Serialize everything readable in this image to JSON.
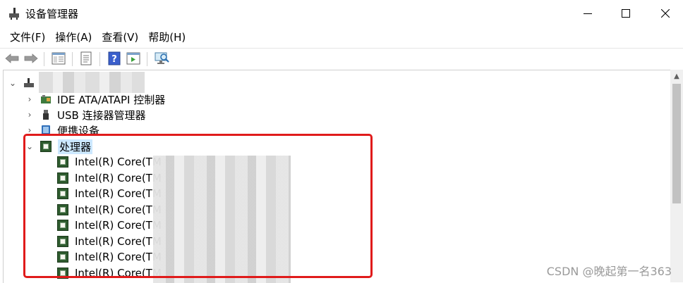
{
  "window": {
    "title": "设备管理器",
    "minimize_glyph": "—",
    "close_glyph": "✕"
  },
  "menu": [
    {
      "label": "文件(F)"
    },
    {
      "label": "操作(A)"
    },
    {
      "label": "查看(V)"
    },
    {
      "label": "帮助(H)"
    }
  ],
  "toolbar": {
    "icons": [
      "back-arrow-icon",
      "forward-arrow-icon",
      "show-hide-tree-icon",
      "properties-icon",
      "help-icon",
      "action-pane-icon",
      "scan-hardware-icon"
    ]
  },
  "tree": {
    "root_chevron": "⌄",
    "collapsed_chevron": "›",
    "expanded_chevron": "⌄",
    "categories": [
      {
        "label": "IDE ATA/ATAPI 控制器",
        "icon": "ide-controller-icon"
      },
      {
        "label": "USB 连接器管理器",
        "icon": "usb-connector-icon"
      },
      {
        "label": "便携设备",
        "icon": "portable-device-icon"
      },
      {
        "label": "处理器",
        "icon": "processor-icon"
      }
    ],
    "processors": [
      {
        "label": "Intel(R) Core(TM"
      },
      {
        "label": "Intel(R) Core(TM"
      },
      {
        "label": "Intel(R) Core(TM"
      },
      {
        "label": "Intel(R) Core(TM"
      },
      {
        "label": "Intel(R) Core(TM"
      },
      {
        "label": "Intel(R) Core(TM"
      },
      {
        "label": "Intel(R) Core(TM"
      },
      {
        "label": "Intel(R) Core(TM"
      }
    ]
  },
  "watermark": "CSDN @晚起第一名363",
  "colors": {
    "highlight_border": "#e01b1b",
    "selection_background": "#cce8ff",
    "processor_icon": "#2e5b2e"
  }
}
